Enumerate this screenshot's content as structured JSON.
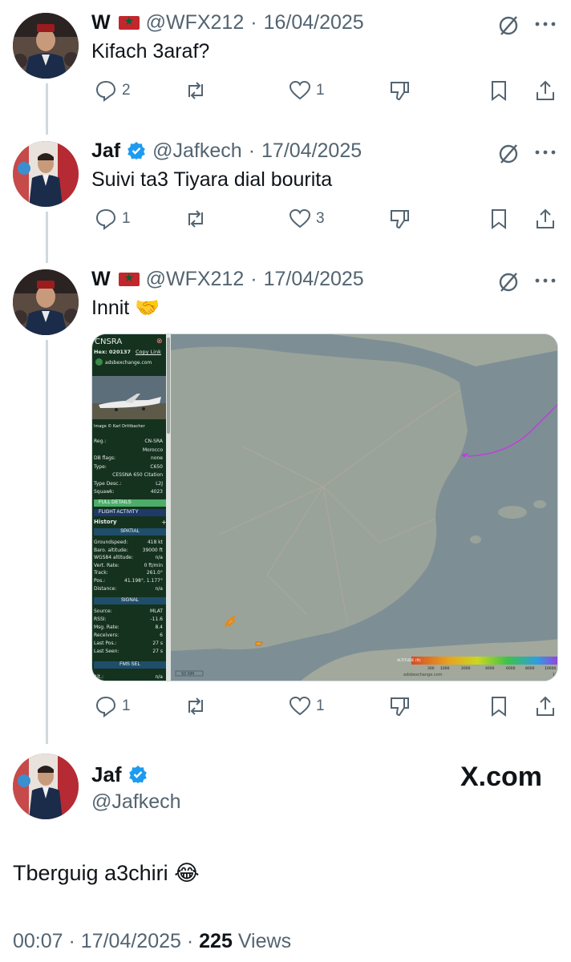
{
  "replies": [
    {
      "name": "W",
      "handle": "@WFX212",
      "date": "16/04/2025",
      "text": "Kifach 3araf?",
      "replies_count": "2",
      "reposts_count": "",
      "likes_count": "1"
    },
    {
      "name": "Jaf",
      "handle": "@Jafkech",
      "date": "17/04/2025",
      "text": "Suivi ta3 Tiyara dial bourita",
      "replies_count": "1",
      "reposts_count": "",
      "likes_count": "3"
    },
    {
      "name": "W",
      "handle": "@WFX212",
      "date": "17/04/2025",
      "text": "Innit 🤝",
      "replies_count": "1",
      "reposts_count": "",
      "likes_count": "1"
    }
  ],
  "separator": "·",
  "map_panel": {
    "callsign": "CNSRA",
    "hex_label": "Hex: 020137",
    "copy_link": "Copy Link",
    "site": "adsbexchange.com",
    "image_credit": "Image © Karl Drittbacher",
    "rows_aircraft": [
      {
        "label": "Reg.:",
        "value": "CN-SRA"
      },
      {
        "label": "",
        "value": "Morocco"
      },
      {
        "label": "DB flags:",
        "value": "none"
      },
      {
        "label": "Type:",
        "value": "C650"
      },
      {
        "label": "",
        "value": "CESSNA 650 Citation"
      },
      {
        "label": "Type Desc.:",
        "value": "L2J"
      },
      {
        "label": "Squawk:",
        "value": "4023"
      }
    ],
    "full_details": "FULL DETAILS",
    "flight_activity": "FLIGHT ACTIVITY",
    "history": "History",
    "spatial": "SPATIAL",
    "rows_spatial": [
      {
        "label": "Groundspeed:",
        "value": "418 kt"
      },
      {
        "label": "Baro. altitude:",
        "value": "39000 ft"
      },
      {
        "label": "WGS84 altitude:",
        "value": "n/a"
      },
      {
        "label": "Vert. Rate:",
        "value": "0 ft/min"
      },
      {
        "label": "Track:",
        "value": "261.0°"
      },
      {
        "label": "Pos.:",
        "value": "41.198°, 1.177°"
      },
      {
        "label": "Distance:",
        "value": "n/a"
      }
    ],
    "signal": "SIGNAL",
    "rows_signal": [
      {
        "label": "Source:",
        "value": "MLAT"
      },
      {
        "label": "RSSI:",
        "value": "-11.6"
      },
      {
        "label": "Msg. Rate:",
        "value": "8.4"
      },
      {
        "label": "Receivers:",
        "value": "6"
      },
      {
        "label": "Last Pos.:",
        "value": "27 s"
      },
      {
        "label": "Last Seen:",
        "value": "27 s"
      }
    ],
    "fms_sel": "FMS SEL",
    "alt_label": "Alt.:",
    "alt_value": "n/a",
    "scale": "50 NM",
    "watermark": "adsbexchange.com",
    "legend_labels": [
      "ALTITUDE (ft)",
      "300",
      "1000",
      "2000",
      "4000",
      "6000",
      "8000",
      "10000",
      "12000"
    ]
  },
  "main": {
    "name": "Jaf",
    "handle": "@Jafkech",
    "xcom": "X.com",
    "text": "Tberguig a3chiri 😂",
    "time": "00:07",
    "date": "17/04/2025",
    "views_count": "225",
    "views_label": "Views"
  },
  "colors": {
    "verified": "#1d9bf0",
    "flag_red": "#c1272d",
    "flag_green": "#006233",
    "text_secondary": "#536471",
    "thread_line": "#cfd9de"
  }
}
